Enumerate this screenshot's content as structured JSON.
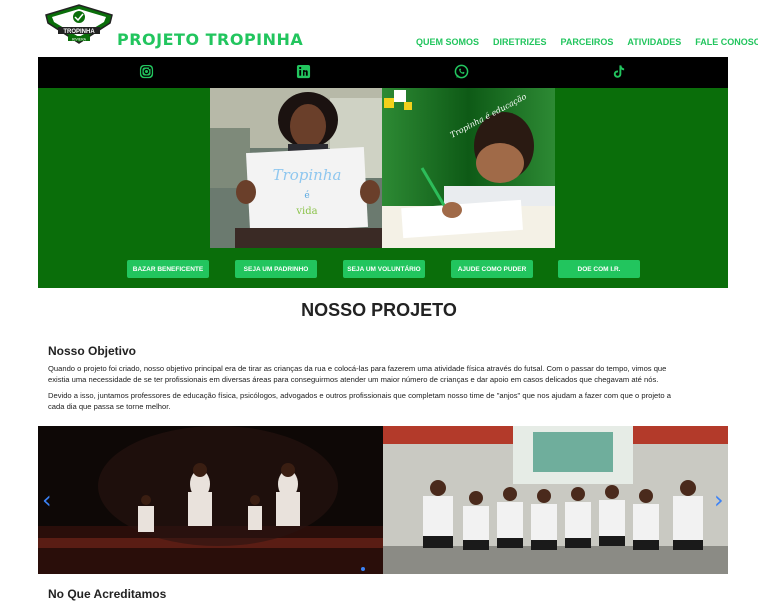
{
  "brand": {
    "name": "PROJETO TROPINHA",
    "logo_text": "TROPINHA",
    "logo_subtext": "RIVIERA",
    "accent": "#22c55e"
  },
  "nav": {
    "items": [
      "QUEM SOMOS",
      "DIRETRIZES",
      "PARCEIROS",
      "ATIVIDADES",
      "FALE CONOSCO"
    ]
  },
  "social": {
    "icons": [
      "instagram-icon",
      "linkedin-icon",
      "whatsapp-icon",
      "tiktok-icon"
    ]
  },
  "hero": {
    "sign_line1": "Tropinha",
    "sign_line2": "é",
    "sign_line3": "vida",
    "photo2_caption": "Tropinha é educação",
    "background": "#0a6e0a"
  },
  "actions": {
    "buttons": [
      "BAZAR BENEFICENTE",
      "SEJA UM PADRINHO",
      "SEJA UM VOLUNTÁRIO",
      "AJUDE COMO PUDER",
      "DOE COM I.R."
    ]
  },
  "main": {
    "title": "NOSSO PROJETO",
    "objective_heading": "Nosso Objetivo",
    "paragraph1_line1": "Quando o projeto foi criado, nosso objetivo principal era de tirar as crianças da rua e colocá-las para fazerem uma atividade física através do futsal. Com o passar do tempo, vimos que",
    "paragraph1_line2": "existia uma necessidade de se ter profissionais em diversas áreas para conseguirmos atender um maior número de crianças e dar apoio em casos delicados que chegavam até nós.",
    "paragraph2_line1": "Devido a isso, juntamos professores de educação física, psicólogos, advogados e outros profissionais que completam nosso time de \"anjos\" que nos ajudam a fazer com que o projeto a",
    "paragraph2_line2": "cada dia que passa se torne melhor.",
    "beliefs_heading": "No Que Acreditamos"
  },
  "carousel": {
    "prev_label": "‹",
    "next_label": "›"
  }
}
